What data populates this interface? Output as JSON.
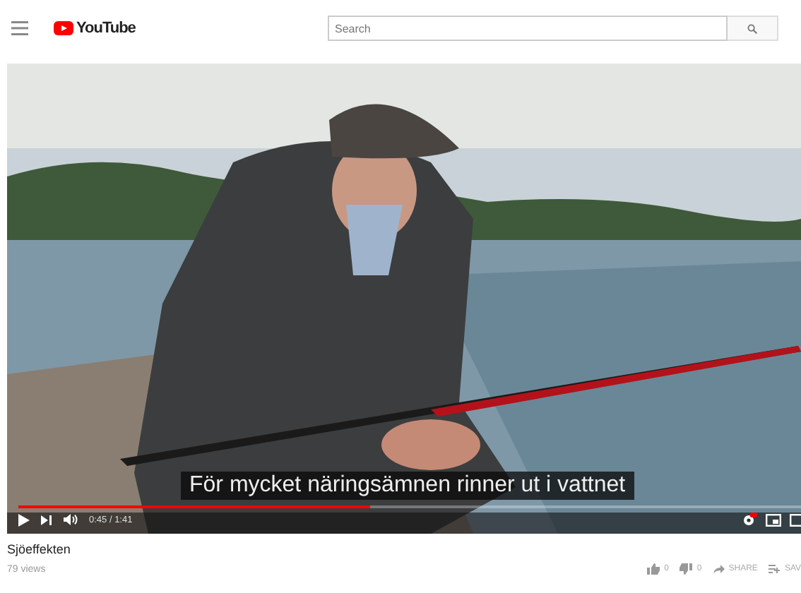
{
  "header": {
    "logo": "YouTube",
    "search": {
      "placeholder": "Search"
    }
  },
  "player": {
    "caption": "För mycket näringsämnen rinner ut i vattnet",
    "time": "0:45 / 1:41",
    "progress": {
      "level": 0.45
    }
  },
  "video": {
    "title": "Sjöeffekten",
    "views": "79 views",
    "likes": "0",
    "dislikes": "0",
    "share": "SHARE",
    "save": "SAV"
  }
}
